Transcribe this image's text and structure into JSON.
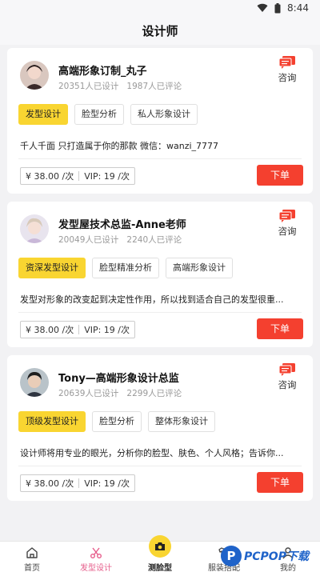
{
  "status_bar": {
    "time": "8:44"
  },
  "header": {
    "title": "设计师"
  },
  "designers": [
    {
      "name": "高端形象订制_丸子",
      "design_count": "20351人已设计",
      "review_count": "1987人已评论",
      "consult_label": "咨询",
      "tags": [
        "发型设计",
        "脸型分析",
        "私人形象设计"
      ],
      "intro": "千人千面 只打造属于你的那款 微信：wanzi_7777",
      "price": "¥ 38.00 /次",
      "vip": "VIP: 19 /次",
      "order_label": "下单"
    },
    {
      "name": "发型屋技术总监-Anne老师",
      "design_count": "20049人已设计",
      "review_count": "2240人已评论",
      "consult_label": "咨询",
      "tags": [
        "资深发型设计",
        "脸型精准分析",
        "高端形象设计"
      ],
      "intro": "发型对形象的改变起到决定性作用，所以找到适合自己的发型很重...",
      "price": "¥ 38.00 /次",
      "vip": "VIP: 19 /次",
      "order_label": "下单"
    },
    {
      "name": "Tony—高端形象设计总监",
      "design_count": "20639人已设计",
      "review_count": "2299人已评论",
      "consult_label": "咨询",
      "tags": [
        "顶级发型设计",
        "脸型分析",
        "整体形象设计"
      ],
      "intro": "设计师将用专业的眼光，分析你的脸型、肤色、个人风格；告诉你...",
      "price": "¥ 38.00 /次",
      "vip": "VIP: 19 /次",
      "order_label": "下单"
    }
  ],
  "tabbar": [
    {
      "label": "首页",
      "icon": "home-icon"
    },
    {
      "label": "发型设计",
      "icon": "scissors-icon"
    },
    {
      "label": "测脸型",
      "icon": "camera-icon"
    },
    {
      "label": "服装搭配",
      "icon": "shirt-icon"
    },
    {
      "label": "我的",
      "icon": "user-icon"
    }
  ],
  "watermark": {
    "logo": "P",
    "text": "PCPOP下载"
  },
  "colors": {
    "accent_yellow": "#f9d531",
    "order_red": "#f4402f",
    "active_tab_pink": "#e65c8a"
  }
}
